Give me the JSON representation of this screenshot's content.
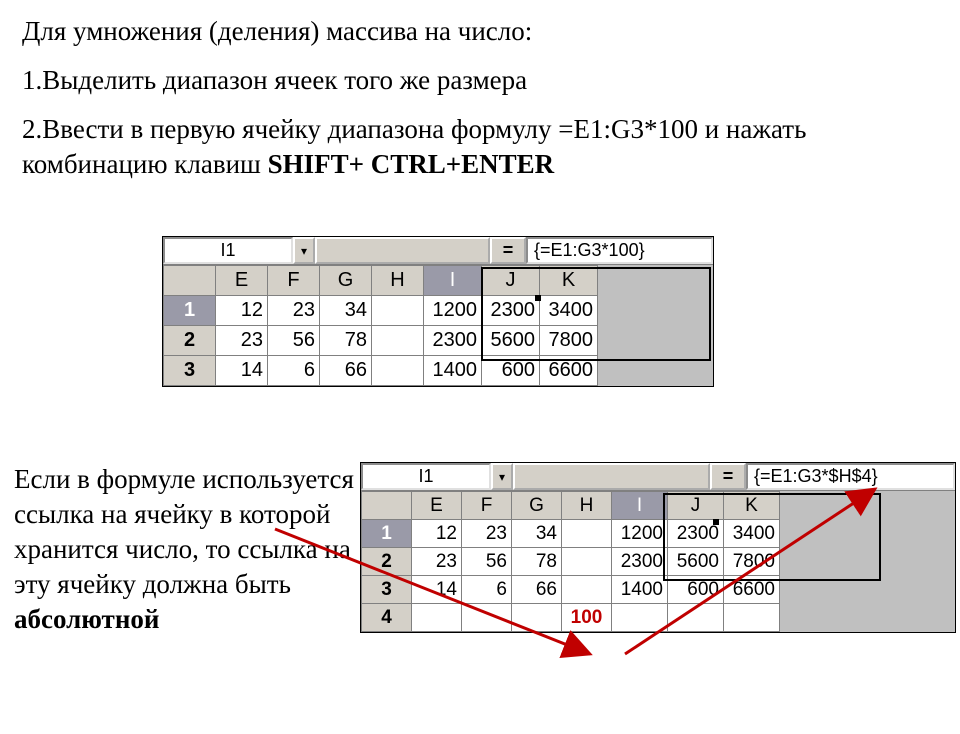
{
  "text": {
    "title": "Для умножения (деления) массива на число:",
    "step1": "1.Выделить диапазон ячеек того же  размера",
    "step2a": "2.Ввести в первую ячейку диапазона формулу =E1:G3*100 и нажать комбинацию клавиш ",
    "step2b": "SHIFT+ CTRL+ENTER",
    "lower1": "Если в формуле используется ссылка на ячейку в которой хранится число, то ссылка на эту ячейку должна быть ",
    "lower2": "абсолютной"
  },
  "sheet1": {
    "namebox": "I1",
    "eq": "=",
    "formula": "{=E1:G3*100}",
    "cols": [
      "E",
      "F",
      "G",
      "H",
      "I",
      "J",
      "K"
    ],
    "rows": [
      "1",
      "2",
      "3"
    ],
    "data": [
      [
        "12",
        "23",
        "34",
        "",
        "1200",
        "2300",
        "3400"
      ],
      [
        "23",
        "56",
        "78",
        "",
        "2300",
        "5600",
        "7800"
      ],
      [
        "14",
        "6",
        "66",
        "",
        "1400",
        "600",
        "6600"
      ]
    ]
  },
  "sheet2": {
    "namebox": "I1",
    "eq": "=",
    "formula": "{=E1:G3*$H$4}",
    "cols": [
      "E",
      "F",
      "G",
      "H",
      "I",
      "J",
      "K"
    ],
    "rows": [
      "1",
      "2",
      "3",
      "4"
    ],
    "data": [
      [
        "12",
        "23",
        "34",
        "",
        "1200",
        "2300",
        "3400"
      ],
      [
        "23",
        "56",
        "78",
        "",
        "2300",
        "5600",
        "7800"
      ],
      [
        "14",
        "6",
        "66",
        "",
        "1400",
        "600",
        "6600"
      ],
      [
        "",
        "",
        "",
        "100",
        "",
        "",
        ""
      ]
    ],
    "red_cell": "100"
  }
}
